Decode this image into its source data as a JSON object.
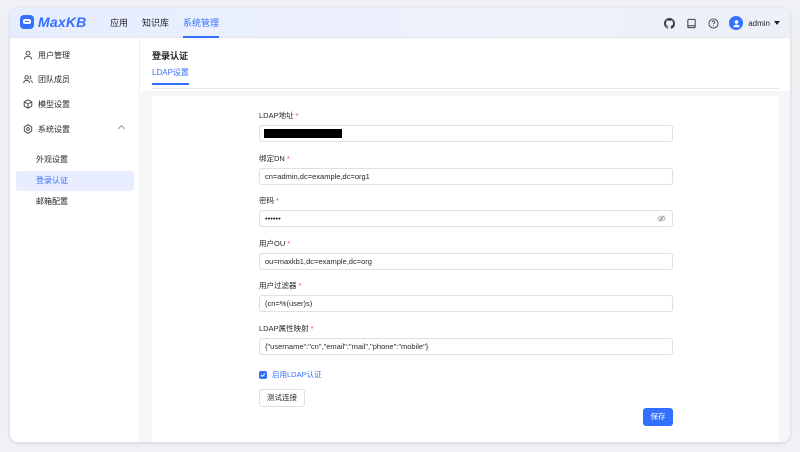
{
  "app": {
    "brand": "MaxKB",
    "accent_color": "#3370ff"
  },
  "header": {
    "nav": [
      {
        "label": "应用",
        "active": false
      },
      {
        "label": "知识库",
        "active": false
      },
      {
        "label": "系统管理",
        "active": true
      }
    ],
    "icons": [
      "github-icon",
      "book-icon",
      "help-icon"
    ],
    "user": {
      "name": "admin"
    }
  },
  "sidebar": {
    "items": [
      {
        "label": "用户管理",
        "icon": "user-icon"
      },
      {
        "label": "团队成员",
        "icon": "team-icon"
      },
      {
        "label": "模型设置",
        "icon": "cube-icon"
      },
      {
        "label": "系统设置",
        "icon": "settings-icon",
        "expanded": true
      }
    ],
    "sub_items": [
      {
        "label": "外观设置",
        "active": false
      },
      {
        "label": "登录认证",
        "active": true
      },
      {
        "label": "邮箱配置",
        "active": false
      }
    ]
  },
  "page": {
    "title": "登录认证",
    "tab": "LDAP设置"
  },
  "form": {
    "fields": [
      {
        "label": "LDAP地址",
        "required": "*",
        "value": "",
        "redacted": true
      },
      {
        "label": "绑定DN",
        "required": "*",
        "value": "cn=admin,dc=example,dc=org1"
      },
      {
        "label": "密码",
        "required": "*",
        "value": "••••••",
        "icon": "eye-off-icon"
      },
      {
        "label": "用户OU",
        "required": "*",
        "value": "ou=maxkb1,dc=example,dc=org"
      },
      {
        "label": "用户过滤器",
        "required": "*",
        "value": "(cn=%(user)s)"
      },
      {
        "label": "LDAP属性映射",
        "required": "*",
        "value": "{\"username\":\"cn\",\"email\":\"mail\",\"phone\":\"mobile\"}"
      }
    ],
    "enable_checkbox": {
      "label": "启用LDAP认证",
      "checked": true
    },
    "test_button": "测试连接",
    "save_button": "保存"
  }
}
